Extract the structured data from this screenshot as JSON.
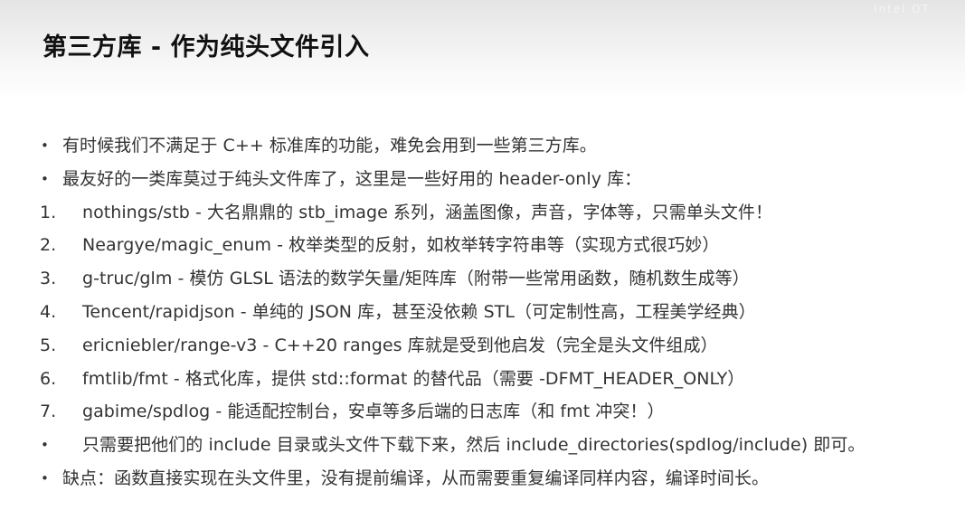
{
  "slide": {
    "title": "第三方库 - 作为纯头文件引入",
    "watermark": "Intel DT"
  },
  "items": [
    {
      "marker": "•",
      "kind": "bullet",
      "text": "有时候我们不满足于 C++ 标准库的功能，难免会用到一些第三方库。"
    },
    {
      "marker": "•",
      "kind": "bullet",
      "text": "最友好的一类库莫过于纯头文件库了，这里是一些好用的 header-only 库："
    },
    {
      "marker": "1.",
      "kind": "numbered",
      "text": "nothings/stb - 大名鼎鼎的 stb_image 系列，涵盖图像，声音，字体等，只需单头文件！"
    },
    {
      "marker": "2.",
      "kind": "numbered",
      "text": "Neargye/magic_enum - 枚举类型的反射，如枚举转字符串等（实现方式很巧妙）"
    },
    {
      "marker": "3.",
      "kind": "numbered",
      "text": "g-truc/glm - 模仿 GLSL 语法的数学矢量/矩阵库（附带一些常用函数，随机数生成等）"
    },
    {
      "marker": "4.",
      "kind": "numbered",
      "text": "Tencent/rapidjson - 单纯的 JSON 库，甚至没依赖 STL（可定制性高，工程美学经典）"
    },
    {
      "marker": "5.",
      "kind": "numbered",
      "text": "ericniebler/range-v3 - C++20 ranges 库就是受到他启发（完全是头文件组成）"
    },
    {
      "marker": "6.",
      "kind": "numbered",
      "text": "fmtlib/fmt - 格式化库，提供 std::format 的替代品（需要 -DFMT_HEADER_ONLY）"
    },
    {
      "marker": "7.",
      "kind": "numbered",
      "text": "gabime/spdlog - 能适配控制台，安卓等多后端的日志库（和 fmt 冲突！）"
    },
    {
      "marker": "•",
      "kind": "indent",
      "text": "只需要把他们的 include 目录或头文件下载下来，然后 include_directories(spdlog/include) 即可。"
    },
    {
      "marker": "•",
      "kind": "bullet",
      "text": "缺点：函数直接实现在头文件里，没有提前编译，从而需要重复编译同样内容，编译时间长。"
    }
  ]
}
